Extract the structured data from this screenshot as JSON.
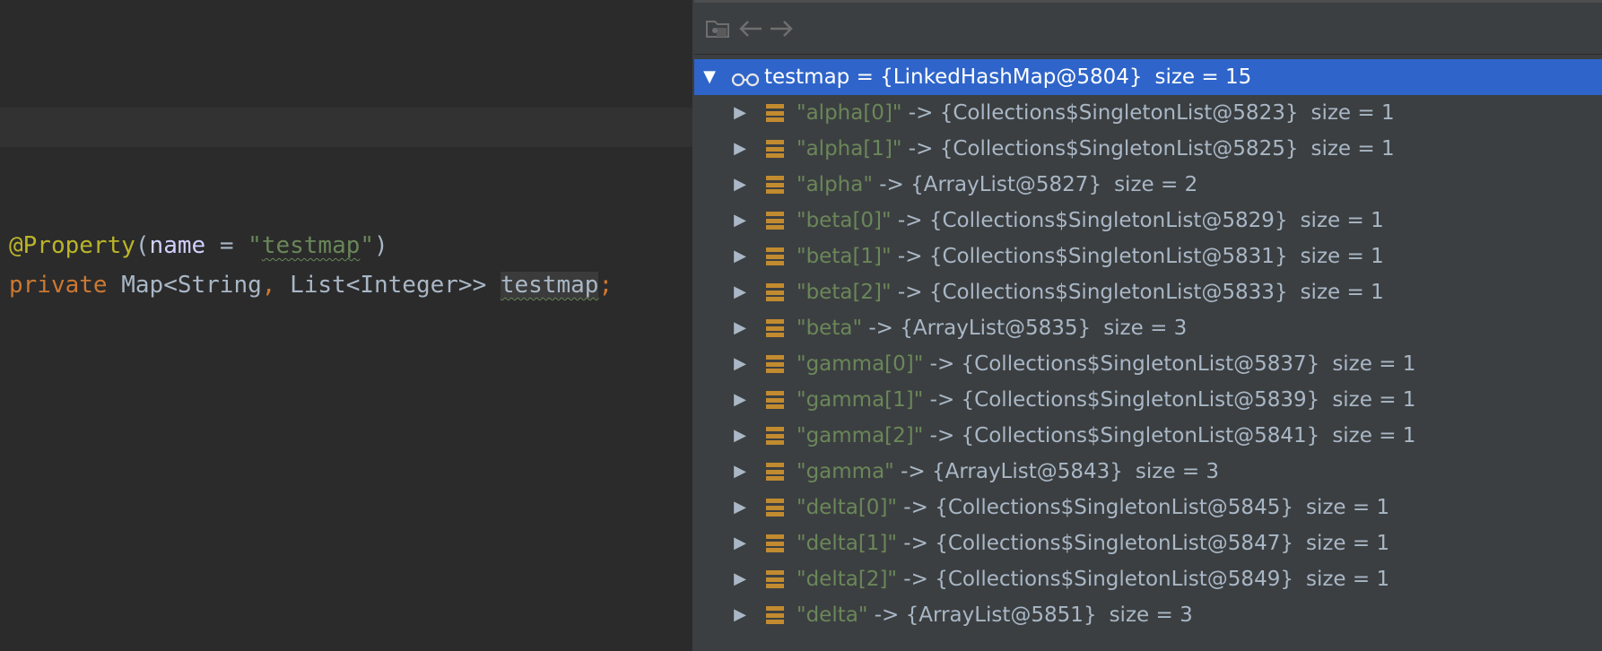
{
  "editor": {
    "line1": {
      "annotation": "@Property",
      "paren_open": "(",
      "param": "name",
      "equals": " = ",
      "quote_open": "\"",
      "string": "testmap",
      "quote_close": "\"",
      "paren_close": ")"
    },
    "line2": {
      "keyword": "private",
      "type_prefix": " Map<String",
      "comma": ",",
      "type_suffix": " List<Integer>> ",
      "field": "testmap",
      "semicolon": ";"
    }
  },
  "toolbar": {
    "buttons": [
      "folder-icon",
      "back-arrow-icon",
      "forward-arrow-icon"
    ]
  },
  "variables": {
    "root": {
      "label": "testmap = {LinkedHashMap@5804}",
      "size": "size = 15",
      "expanded": true
    },
    "entries": [
      {
        "key": "\"alpha[0]\"",
        "arrow": " -> ",
        "value": "{Collections$SingletonList@5823}",
        "size": "size = 1"
      },
      {
        "key": "\"alpha[1]\"",
        "arrow": " -> ",
        "value": "{Collections$SingletonList@5825}",
        "size": "size = 1"
      },
      {
        "key": "\"alpha\"",
        "arrow": " -> ",
        "value": "{ArrayList@5827}",
        "size": "size = 2"
      },
      {
        "key": "\"beta[0]\"",
        "arrow": " -> ",
        "value": "{Collections$SingletonList@5829}",
        "size": "size = 1"
      },
      {
        "key": "\"beta[1]\"",
        "arrow": " -> ",
        "value": "{Collections$SingletonList@5831}",
        "size": "size = 1"
      },
      {
        "key": "\"beta[2]\"",
        "arrow": " -> ",
        "value": "{Collections$SingletonList@5833}",
        "size": "size = 1"
      },
      {
        "key": "\"beta\"",
        "arrow": " -> ",
        "value": "{ArrayList@5835}",
        "size": "size = 3"
      },
      {
        "key": "\"gamma[0]\"",
        "arrow": " -> ",
        "value": "{Collections$SingletonList@5837}",
        "size": "size = 1"
      },
      {
        "key": "\"gamma[1]\"",
        "arrow": " -> ",
        "value": "{Collections$SingletonList@5839}",
        "size": "size = 1"
      },
      {
        "key": "\"gamma[2]\"",
        "arrow": " -> ",
        "value": "{Collections$SingletonList@5841}",
        "size": "size = 1"
      },
      {
        "key": "\"gamma\"",
        "arrow": " -> ",
        "value": "{ArrayList@5843}",
        "size": "size = 3"
      },
      {
        "key": "\"delta[0]\"",
        "arrow": " -> ",
        "value": "{Collections$SingletonList@5845}",
        "size": "size = 1"
      },
      {
        "key": "\"delta[1]\"",
        "arrow": " -> ",
        "value": "{Collections$SingletonList@5847}",
        "size": "size = 1"
      },
      {
        "key": "\"delta[2]\"",
        "arrow": " -> ",
        "value": "{Collections$SingletonList@5849}",
        "size": "size = 1"
      },
      {
        "key": "\"delta\"",
        "arrow": " -> ",
        "value": "{ArrayList@5851}",
        "size": "size = 3"
      }
    ]
  },
  "colors": {
    "selection": "#2f65ca",
    "string_green": "#6a8759",
    "keyword_orange": "#cc7832",
    "annotation_yellow": "#bbb529",
    "field_icon": "#c28b2f"
  }
}
